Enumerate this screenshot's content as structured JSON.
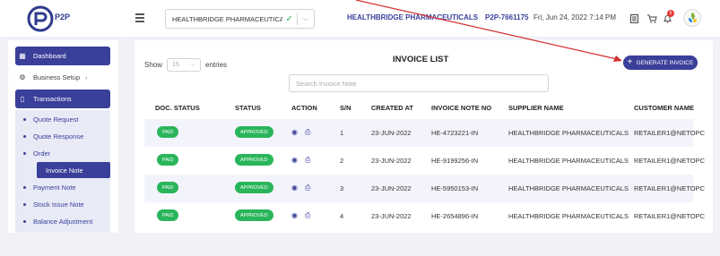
{
  "header": {
    "logo_text": "P2P",
    "company_select": "HEALTHBRIDGE PHARMACEUTICALS",
    "org_name": "HEALTHBRIDGE PHARMACEUTICALS",
    "pid": "P2P-7661175",
    "datetime": "Fri, Jun 24, 2022 7:14 PM",
    "notification_count": "5",
    "icons": [
      "menu-icon",
      "check-icon",
      "chevron-down-icon",
      "document-icon",
      "cart-icon",
      "bell-icon",
      "avatar"
    ]
  },
  "sidebar": {
    "dashboard": "Dashboard",
    "business_setup": "Business Setup",
    "transactions": "Transactions",
    "sub_items": [
      "Quote Request",
      "Quote Response",
      "Order",
      "Invoice Note",
      "Payment Note",
      "Stock Issue Note",
      "Balance Adjustment"
    ]
  },
  "main": {
    "show_label": "Show",
    "show_value": "15",
    "entries_label": "entries",
    "title": "INVOICE LIST",
    "generate_button": "GENERATE INVOICE",
    "search_placeholder": "Search Invoice Note",
    "columns": [
      "DOC. STATUS",
      "STATUS",
      "ACTION",
      "S/N",
      "CREATED AT",
      "INVOICE NOTE NO",
      "SUPPLIER NAME",
      "CUSTOMER NAME"
    ],
    "rows": [
      {
        "doc_status": "PAID",
        "status": "APPROVED",
        "sn": "1",
        "created_at": "23-JUN-2022",
        "invoice_no": "HE-4723221-IN",
        "supplier": "HEALTHBRIDGE PHARMACEUTICALS",
        "customer": "RETAILER1@NETOPC"
      },
      {
        "doc_status": "PAID",
        "status": "APPROVED",
        "sn": "2",
        "created_at": "23-JUN-2022",
        "invoice_no": "HE-9199256-IN",
        "supplier": "HEALTHBRIDGE PHARMACEUTICALS",
        "customer": "RETAILER1@NETOPC"
      },
      {
        "doc_status": "PAID",
        "status": "APPROVED",
        "sn": "3",
        "created_at": "23-JUN-2022",
        "invoice_no": "HE-5950153-IN",
        "supplier": "HEALTHBRIDGE PHARMACEUTICALS",
        "customer": "RETAILER1@NETOPC"
      },
      {
        "doc_status": "PAID",
        "status": "APPROVED",
        "sn": "4",
        "created_at": "23-JUN-2022",
        "invoice_no": "HE-2654896-IN",
        "supplier": "HEALTHBRIDGE PHARMACEUTICALS",
        "customer": "RETAILER1@NETOPC"
      }
    ]
  },
  "colors": {
    "primary": "#3a3f9a",
    "success": "#2ab55b",
    "annotation_arrow": "#d32f2f"
  }
}
